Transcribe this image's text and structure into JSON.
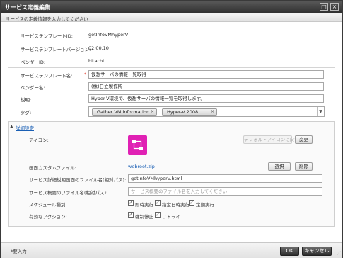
{
  "dialog": {
    "title": "サービス定義編集",
    "subtitle": "サービスの定義情報を入力してください",
    "maximize_glyph": "□",
    "close_glyph": "×"
  },
  "info": {
    "template_id_label": "サービステンプレートID:",
    "template_id_value": "getInfoVMhyperV",
    "version_label": "サービステンプレートバージョン:",
    "version_value": "02.00.10",
    "vendor_id_label": "ベンダーID:",
    "vendor_id_value": "hitachi"
  },
  "form": {
    "template_name_label": "サービステンプレート名:",
    "required_mark": "*",
    "template_name_value": "仮想サーバの情報一覧取得",
    "vendor_name_label": "ベンダー名:",
    "vendor_name_value": "(株)日立製作所",
    "description_label": "説明:",
    "description_value": "Hyper-V環境で、仮想サーバの情報一覧を取得します。",
    "tag_label": "タグ:",
    "tags": [
      "Gather VM information",
      "Hyper-V 2008"
    ],
    "tag_remove_glyph": "×",
    "tag_dropdown_glyph": "▼"
  },
  "advanced": {
    "toggle_glyph": "▲",
    "toggle_label": "詳細設定",
    "icon_label": "アイコン:",
    "default_icon_button": "デフォルトアイコンに戻す",
    "change_button": "変更",
    "custom_file_label": "画面カスタムファイル:",
    "custom_file_link": "webroot.zip",
    "select_button": "選択",
    "delete_button": "削除",
    "detail_file_label": "サービス詳細説明画面のファイル名(相対パス):",
    "detail_file_value": "getInfoVMhyperV.html",
    "summary_file_label": "サービス概要のファイル名(相対パス):",
    "summary_file_placeholder": "サービス概要のファイル名を入力してください",
    "schedule_label": "スケジュール種別:",
    "schedule_options": [
      "即時実行",
      "指定日時実行",
      "定期実行"
    ],
    "action_label": "有効なアクション:",
    "action_options": [
      "強制停止",
      "リトライ"
    ],
    "check_glyph": "✓"
  },
  "footer": {
    "required_note": "*要入力",
    "ok_button": "OK",
    "cancel_button": "キャンセル",
    "resize_glyph": "⋰"
  },
  "colors": {
    "title_bar": "#3a3a3a",
    "link": "#1a5fb4",
    "icon_magenta": "#e021b4",
    "required": "#d21111"
  }
}
